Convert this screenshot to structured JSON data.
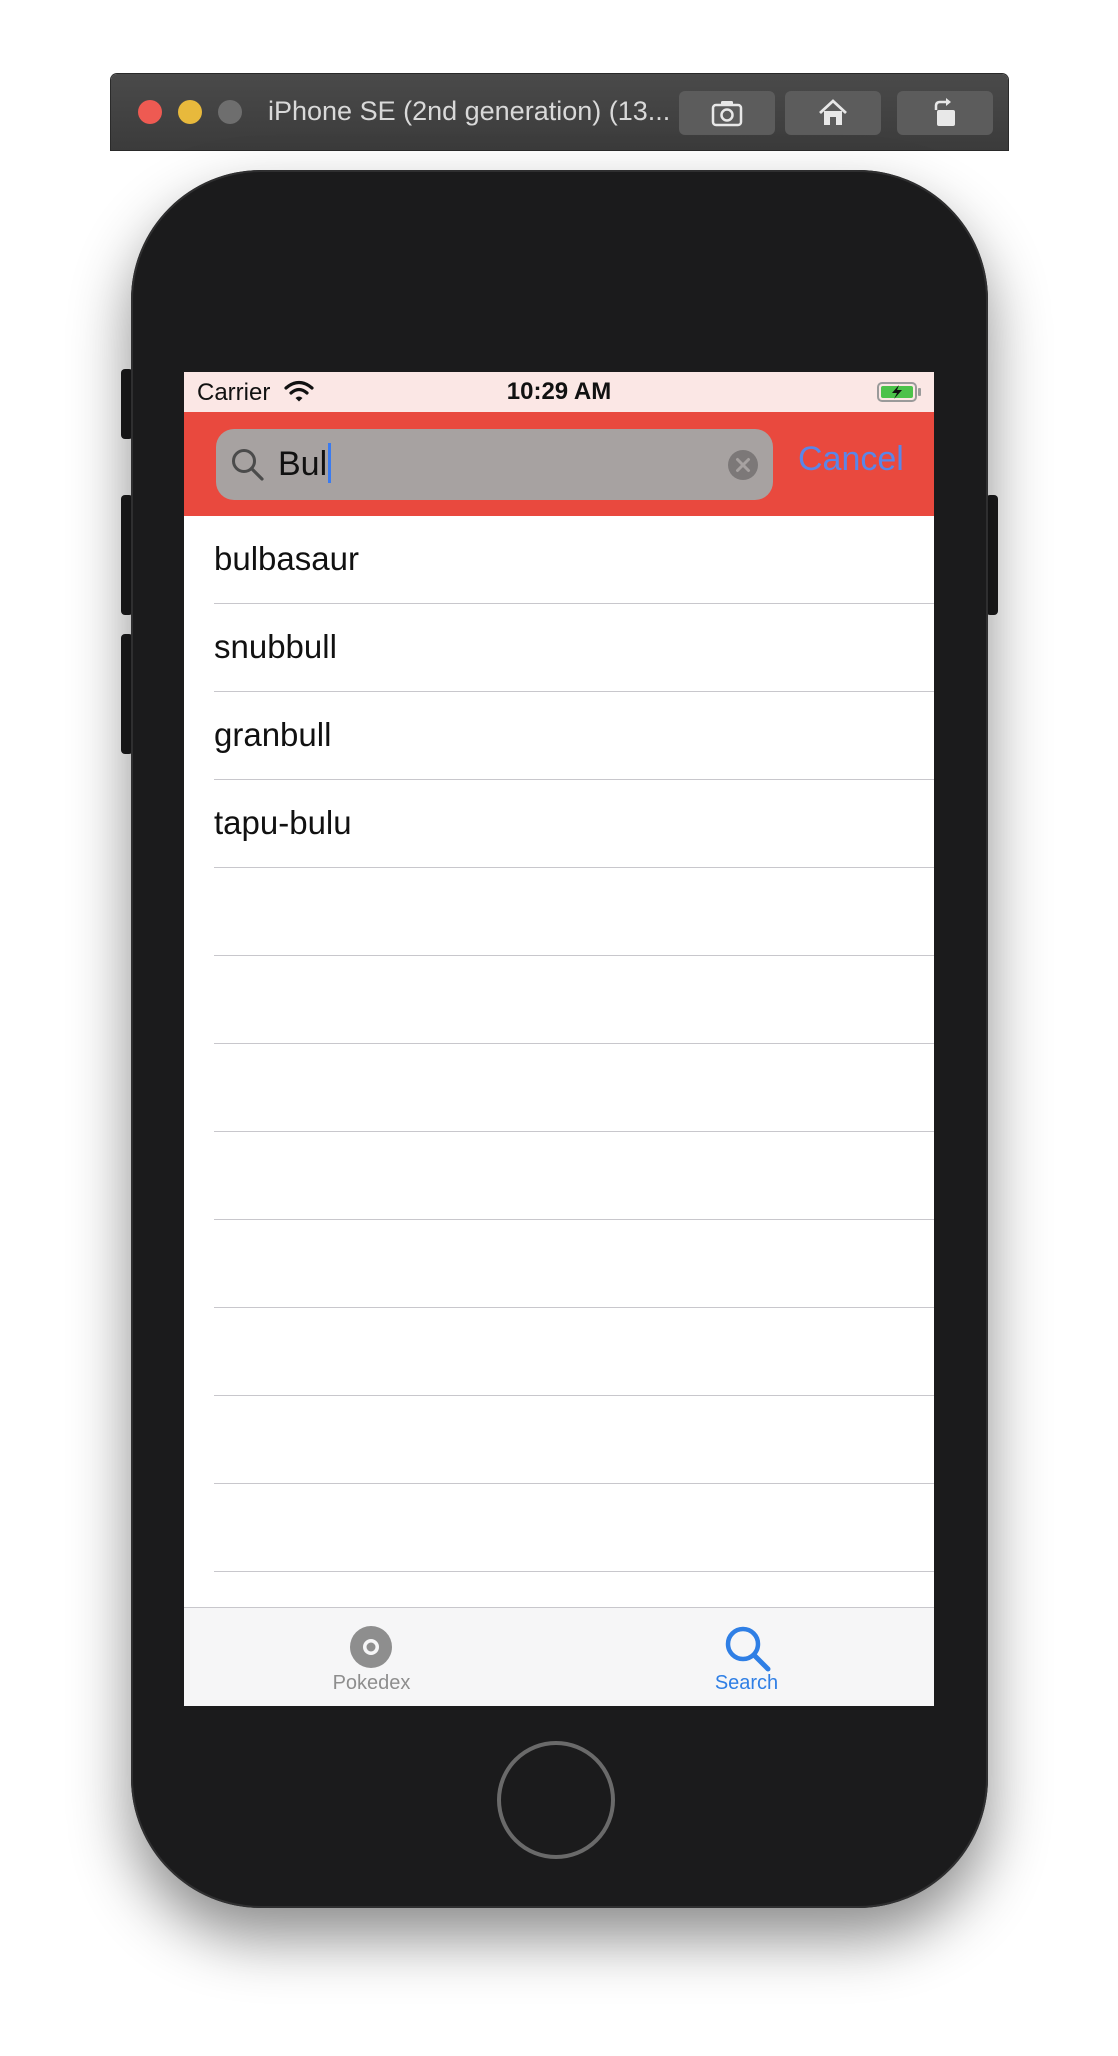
{
  "simulator": {
    "title": "iPhone SE (2nd generation) (13...",
    "buttons": [
      "screenshot-icon",
      "home-icon",
      "rotate-icon"
    ]
  },
  "status_bar": {
    "carrier": "Carrier",
    "time": "10:29 AM"
  },
  "search": {
    "value": "Bul",
    "cancel_label": "Cancel"
  },
  "results": [
    {
      "name": "bulbasaur"
    },
    {
      "name": "snubbull"
    },
    {
      "name": "granbull"
    },
    {
      "name": "tapu-bulu"
    }
  ],
  "tabs": [
    {
      "label": "Pokedex",
      "icon": "pokeball-icon",
      "selected": false
    },
    {
      "label": "Search",
      "icon": "search-icon",
      "selected": true
    }
  ],
  "colors": {
    "nav_bar": "#e9493e",
    "accent": "#2f7fe5",
    "status_bar": "#fbe7e5"
  }
}
